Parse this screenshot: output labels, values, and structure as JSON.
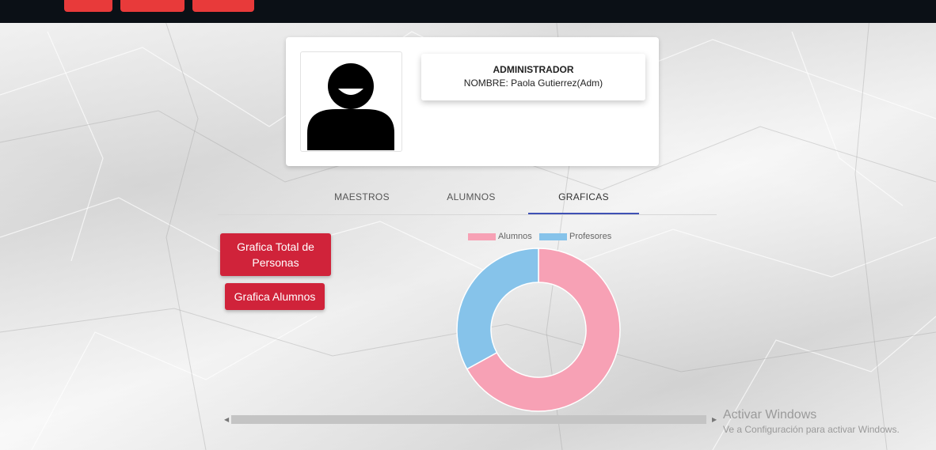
{
  "profile": {
    "role": "ADMINISTRADOR",
    "name": "NOMBRE: Paola Gutierrez(Adm)"
  },
  "tabs": [
    {
      "label": "MAESTROS",
      "active": false
    },
    {
      "label": "ALUMNOS",
      "active": false
    },
    {
      "label": "GRAFICAS",
      "active": true
    }
  ],
  "buttons": {
    "total_line1": "Grafica Total de",
    "total_line2": "Personas",
    "alumnos": "Grafica Alumnos"
  },
  "chart_data": {
    "type": "pie",
    "labels": [
      "Alumnos",
      "Profesores"
    ],
    "values": [
      67,
      33
    ],
    "colors": [
      "#f7a1b5",
      "#86c3ea"
    ],
    "legend_position": "top"
  },
  "watermark": {
    "title": "Activar Windows",
    "subtitle": "Ve a Configuración para activar Windows."
  },
  "colors": {
    "accent_red": "#d0233a",
    "tab_indicator": "#3f51b5",
    "topbar": "#0b1016"
  }
}
